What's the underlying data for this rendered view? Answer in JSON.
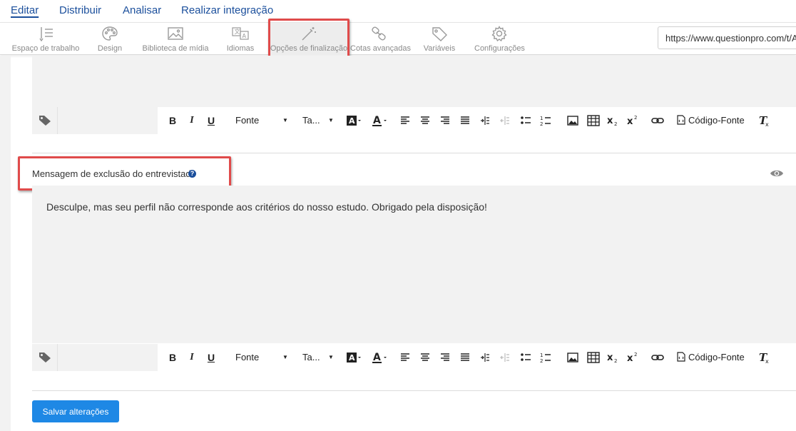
{
  "topnav": {
    "items": [
      "Editar",
      "Distribuir",
      "Analisar",
      "Realizar integração"
    ]
  },
  "toolbar": {
    "items": [
      {
        "label": "Espaço de trabalho",
        "icon": "workspace-icon"
      },
      {
        "label": "Design",
        "icon": "palette-icon"
      },
      {
        "label": "Biblioteca de mídia",
        "icon": "image-icon"
      },
      {
        "label": "Idiomas",
        "icon": "translate-icon"
      },
      {
        "label": "Opções de finalização",
        "icon": "magic-wand-icon"
      },
      {
        "label": "Cotas avançadas",
        "icon": "link-icon"
      },
      {
        "label": "Variáveis",
        "icon": "tag-icon"
      },
      {
        "label": "Configurações",
        "icon": "gear-icon"
      }
    ],
    "selected": "Opções de finalização",
    "url": "https://www.questionpro.com/t/A"
  },
  "rte": {
    "font_label": "Fonte",
    "size_label": "Ta...",
    "source_label": "Código-Fonte",
    "bold": "B",
    "italic": "I",
    "underline": "U"
  },
  "exclusion": {
    "label": "Mensagem de exclusão do entrevistado",
    "help": "?",
    "message": "Desculpe, mas seu perfil não corresponde aos critérios do nosso estudo. Obrigado pela disposição!"
  },
  "save_label": "Salvar alterações",
  "colors": {
    "accent": "#1b4f9c",
    "button": "#1e88e5",
    "highlight": "#e04b4b"
  }
}
